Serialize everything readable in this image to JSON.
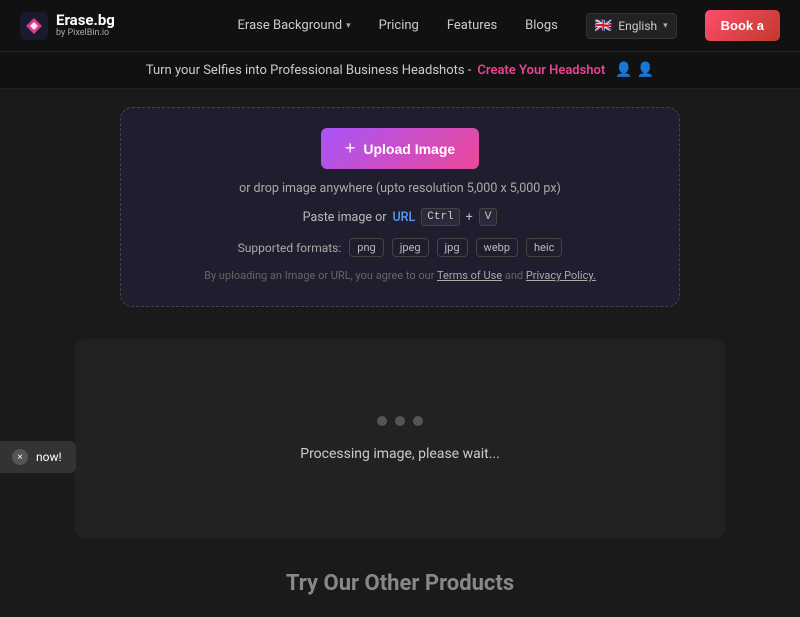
{
  "navbar": {
    "logo_main": "Erase.bg",
    "logo_sub": "by PixelBin.io",
    "nav_items": [
      {
        "label": "Erase Background",
        "has_dropdown": true
      },
      {
        "label": "Pricing",
        "has_dropdown": false
      },
      {
        "label": "Features",
        "has_dropdown": false
      },
      {
        "label": "Blogs",
        "has_dropdown": false
      }
    ],
    "lang": "English",
    "book_label": "Book a"
  },
  "promo": {
    "text": "Turn your Selfies into Professional Business Headshots -",
    "link_text": "Create Your Headshot"
  },
  "upload": {
    "btn_label": "Upload Image",
    "drop_text": "or drop image anywhere (upto resolution 5,000 x 5,000 px)",
    "paste_prefix": "Paste image or",
    "url_label": "URL",
    "kbd1": "Ctrl",
    "kbd_plus": "+",
    "kbd2": "V",
    "formats_label": "Supported formats:",
    "formats": [
      "png",
      "jpeg",
      "jpg",
      "webp",
      "heic"
    ],
    "terms_text": "By uploading an Image or URL, you agree to our",
    "terms_link": "Terms of Use",
    "and": "and",
    "privacy_link": "Privacy Policy."
  },
  "processing": {
    "text": "Processing image, please wait...",
    "dots": [
      false,
      false,
      false
    ]
  },
  "toast": {
    "text": "now!",
    "close_label": "×"
  },
  "bottom": {
    "heading": "Try Our Other Products"
  }
}
